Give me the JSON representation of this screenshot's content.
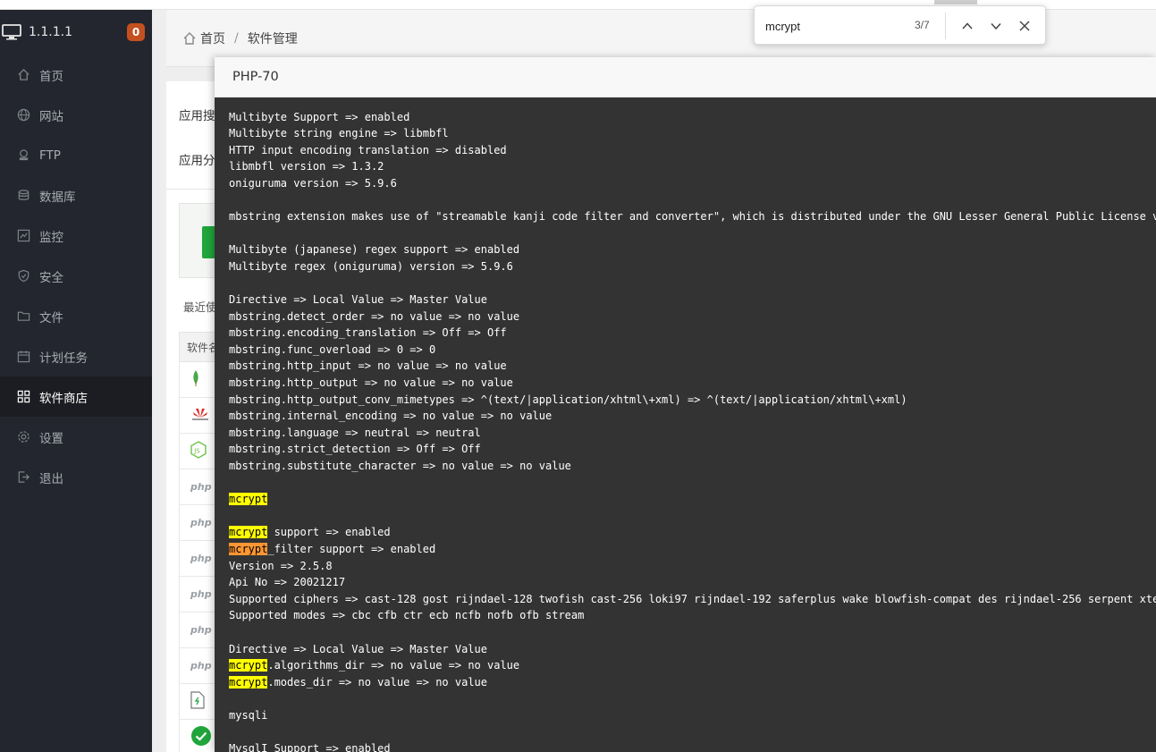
{
  "sidebar": {
    "server_ip": "1.1.1.1",
    "badge": "0",
    "items": [
      {
        "label": "首页",
        "icon": "home-icon"
      },
      {
        "label": "网站",
        "icon": "globe-icon"
      },
      {
        "label": "FTP",
        "icon": "ftp-icon"
      },
      {
        "label": "数据库",
        "icon": "database-icon"
      },
      {
        "label": "监控",
        "icon": "monitor-icon"
      },
      {
        "label": "安全",
        "icon": "shield-icon"
      },
      {
        "label": "文件",
        "icon": "folder-icon"
      },
      {
        "label": "计划任务",
        "icon": "calendar-icon"
      },
      {
        "label": "软件商店",
        "icon": "grid-icon",
        "active": true
      },
      {
        "label": "设置",
        "icon": "gear-icon"
      },
      {
        "label": "退出",
        "icon": "logout-icon"
      }
    ]
  },
  "breadcrumb": {
    "home": "首页",
    "separator": "/",
    "current": "软件管理"
  },
  "panel": {
    "label_search": "应用搜",
    "label_category": "应用分",
    "recent": "最近使",
    "table_header": "软件名"
  },
  "modal": {
    "title": "PHP-70",
    "lines": [
      "Multibyte Support => enabled",
      "Multibyte string engine => libmbfl",
      "HTTP input encoding translation => disabled",
      "libmbfl version => 1.3.2",
      "oniguruma version => 5.9.6",
      "",
      "mbstring extension makes use of \"streamable kanji code filter and converter\", which is distributed under the GNU Lesser General Public License ve",
      "",
      "Multibyte (japanese) regex support => enabled",
      "Multibyte regex (oniguruma) version => 5.9.6",
      "",
      "Directive => Local Value => Master Value",
      "mbstring.detect_order => no value => no value",
      "mbstring.encoding_translation => Off => Off",
      "mbstring.func_overload => 0 => 0",
      "mbstring.http_input => no value => no value",
      "mbstring.http_output => no value => no value",
      "mbstring.http_output_conv_mimetypes => ^(text/|application/xhtml\\+xml) => ^(text/|application/xhtml\\+xml)",
      "mbstring.internal_encoding => no value => no value",
      "mbstring.language => neutral => neutral",
      "mbstring.strict_detection => Off => Off",
      "mbstring.substitute_character => no value => no value",
      "",
      "mcrypt",
      "",
      "mcrypt support => enabled",
      "mcrypt_filter support => enabled",
      "Version => 2.5.8",
      "Api No => 20021217",
      "Supported ciphers => cast-128 gost rijndael-128 twofish cast-256 loki97 rijndael-192 saferplus wake blowfish-compat des rijndael-256 serpent xtea",
      "Supported modes => cbc cfb ctr ecb ncfb nofb ofb stream",
      "",
      "Directive => Local Value => Master Value",
      "mcrypt.algorithms_dir => no value => no value",
      "mcrypt.modes_dir => no value => no value",
      "",
      "mysqli",
      "",
      "MysqlI Support => enabled"
    ]
  },
  "findbar": {
    "query": "mcrypt",
    "count": "3/7",
    "current_match_index": 2
  },
  "colors": {
    "sidebar_bg": "#23262e",
    "modal_bg": "#333333",
    "highlight": "#ffff00",
    "current_highlight": "#ff9632",
    "badge": "#c4501f",
    "accent_green": "#20a53a"
  }
}
